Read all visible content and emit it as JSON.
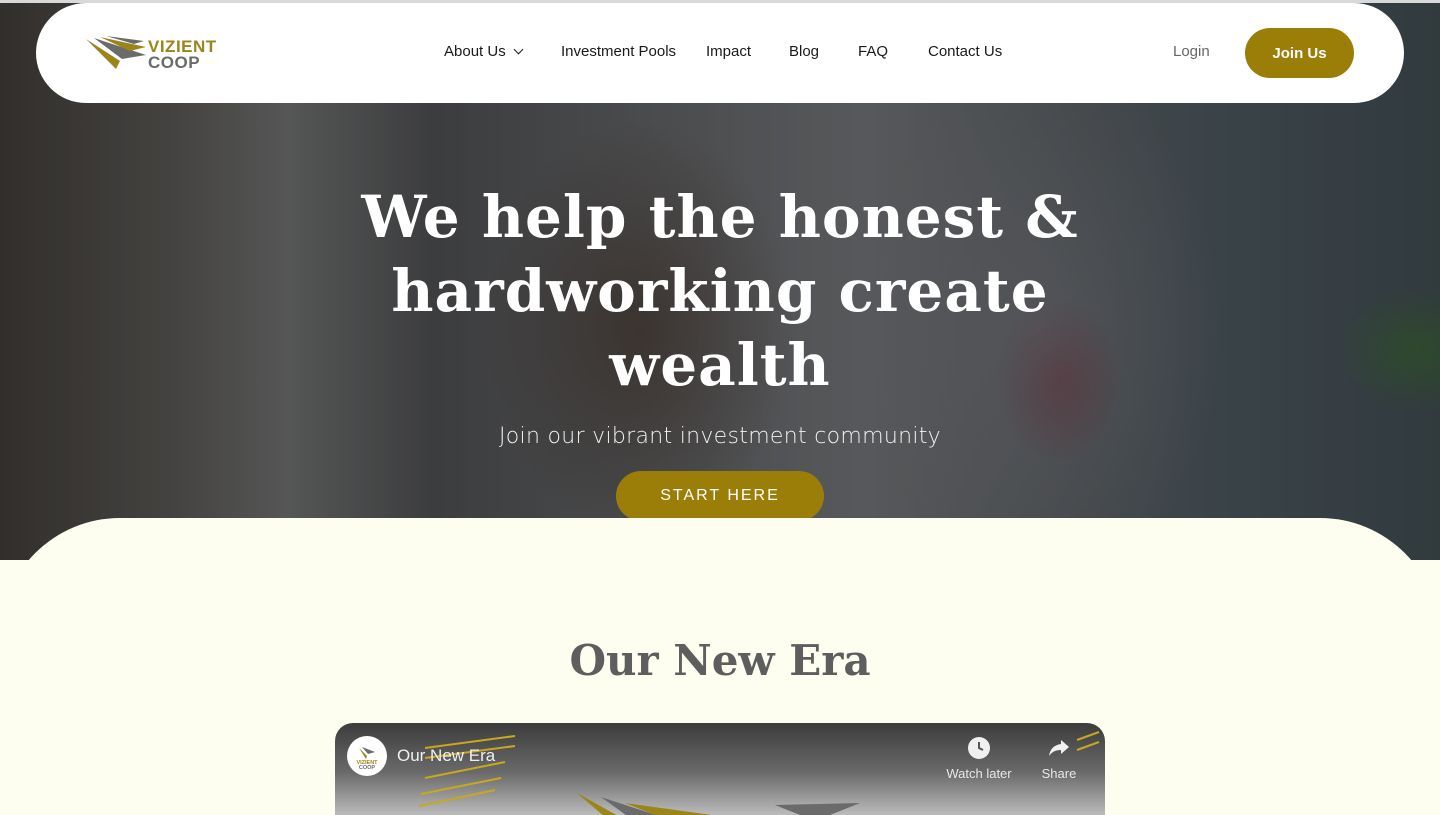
{
  "brand": {
    "name_line1": "VIZIENT",
    "name_line2": "COOP",
    "gold": "#9b7e08",
    "gray": "#6b6b6b"
  },
  "nav": {
    "items": [
      {
        "label": "About Us",
        "has_dropdown": true
      },
      {
        "label": "Investment Pools"
      },
      {
        "label": "Impact"
      },
      {
        "label": "Blog"
      },
      {
        "label": "FAQ"
      },
      {
        "label": "Contact Us"
      }
    ],
    "login_label": "Login",
    "join_label": "Join Us"
  },
  "hero": {
    "title_line1": "We help the honest &",
    "title_line2": "hardworking create wealth",
    "subtitle": "Join our vibrant investment community",
    "cta_label": "START HERE"
  },
  "section": {
    "title": "Our New Era"
  },
  "video": {
    "title": "Our New Era",
    "channel_line1": "VIZIENT",
    "channel_line2": "COOP",
    "watch_later_label": "Watch later",
    "share_label": "Share",
    "icons": [
      "clock-icon",
      "share-icon"
    ]
  }
}
